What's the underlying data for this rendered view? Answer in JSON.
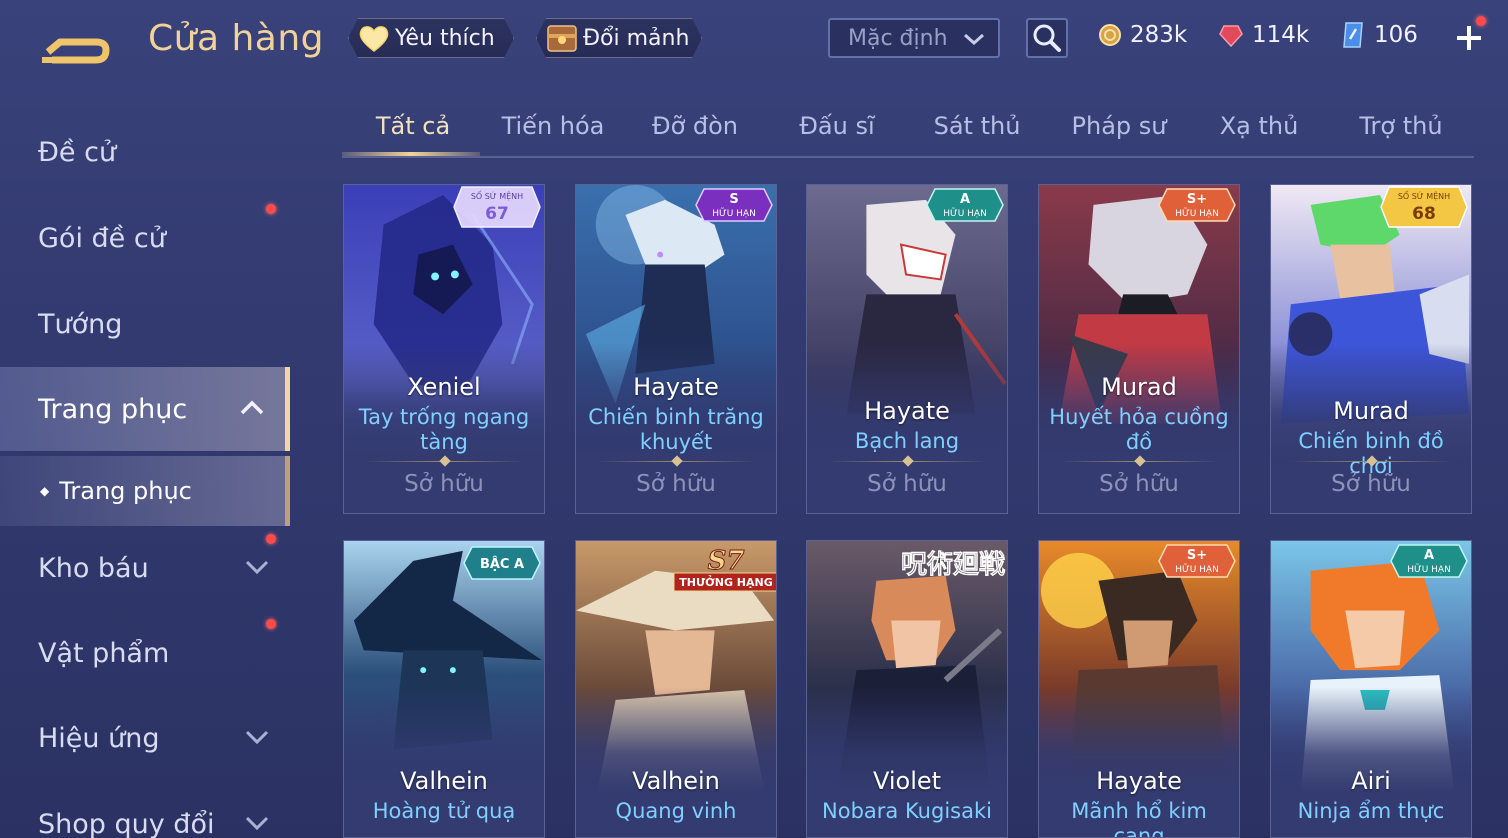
{
  "header": {
    "title": "Cửa hàng",
    "favorite_label": "Yêu thích",
    "shard_exchange_label": "Đổi mảnh",
    "sort_value": "Mặc định",
    "currencies": [
      {
        "name": "gold",
        "value": "283k"
      },
      {
        "name": "ruby",
        "value": "114k"
      },
      {
        "name": "voucher",
        "value": "106"
      }
    ]
  },
  "sidebar": {
    "items": [
      {
        "label": "Đề cử"
      },
      {
        "label": "Gói đề cử"
      },
      {
        "label": "Tướng"
      },
      {
        "label": "Trang phục"
      },
      {
        "label": "Kho báu"
      },
      {
        "label": "Vật phẩm"
      },
      {
        "label": "Hiệu ứng"
      },
      {
        "label": "Shop quy đổi"
      }
    ],
    "sub_item": "Trang phục"
  },
  "tabs": [
    "Tất cả",
    "Tiến hóa",
    "Đỡ đòn",
    "Đấu sĩ",
    "Sát thủ",
    "Pháp sư",
    "Xạ thủ",
    "Trợ thủ"
  ],
  "cards": [
    {
      "hero": "Xeniel",
      "skin": "Tay trống ngang tàng",
      "status": "Sở hữu",
      "badge_top": "SỐ SỨ MỆNH",
      "badge_main": "67"
    },
    {
      "hero": "Hayate",
      "skin": "Chiến binh trăng khuyết",
      "status": "Sở hữu",
      "badge_main": "S",
      "badge_sub": "HỮU HẠN"
    },
    {
      "hero": "Hayate",
      "skin": "Bạch lang",
      "status": "Sở hữu",
      "badge_main": "A",
      "badge_sub": "HỮU HẠN"
    },
    {
      "hero": "Murad",
      "skin": "Huyết hỏa cuồng đồ",
      "status": "Sở hữu",
      "badge_main": "S+",
      "badge_sub": "HỮU HẠN"
    },
    {
      "hero": "Murad",
      "skin": "Chiến binh đồ chơi",
      "status": "Sở hữu",
      "badge_top": "SỐ SỨ MỆNH",
      "badge_main": "68"
    },
    {
      "hero": "Valhein",
      "skin": "Hoàng tử quạ",
      "badge_main": "BẬC A"
    },
    {
      "hero": "Valhein",
      "skin": "Quang vinh",
      "badge_main": "S7",
      "badge_sub": "THƯỞNG HẠNG"
    },
    {
      "hero": "Violet",
      "skin": "Nobara Kugisaki",
      "badge_main": "呪術廻戦"
    },
    {
      "hero": "Hayate",
      "skin": "Mãnh hổ kim cang",
      "badge_main": "S+",
      "badge_sub": "HỮU HẠN"
    },
    {
      "hero": "Airi",
      "skin": "Ninja ẩm thực",
      "badge_main": "A",
      "badge_sub": "HỮU HẠN"
    }
  ],
  "colors": {
    "title_gold": "#f1d39a",
    "skin_blue": "#7fd0ff",
    "notification_red": "#ff4a4a",
    "background": "#323a70"
  },
  "icons": [
    "back-arrow-icon",
    "heart-icon",
    "chest-icon",
    "chevron-down-icon",
    "search-icon",
    "gold-coin-icon",
    "ruby-icon",
    "voucher-icon",
    "plus-icon",
    "chevron-up-icon"
  ]
}
